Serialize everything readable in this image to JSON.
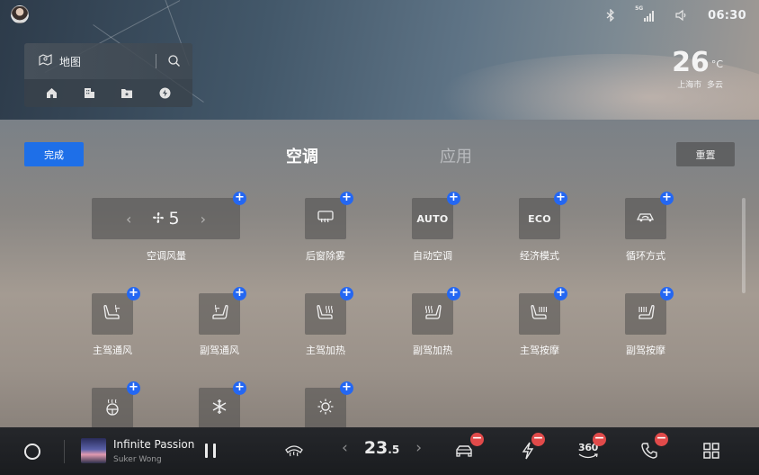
{
  "status_bar": {
    "network": "5G",
    "time": "06:30",
    "icons": [
      "bluetooth-icon",
      "signal-5g-icon",
      "volume-icon"
    ]
  },
  "map_widget": {
    "search_label": "地图",
    "icons": [
      "map-pin-icon",
      "search-icon"
    ],
    "shortcuts": [
      "home-icon",
      "office-icon",
      "favorite-folder-icon",
      "charging-icon"
    ]
  },
  "weather": {
    "temperature": "26",
    "unit": "°C",
    "location": "上海市",
    "condition": "多云"
  },
  "panel": {
    "done_label": "完成",
    "reset_label": "重置",
    "tabs": [
      {
        "label": "空调",
        "active": true
      },
      {
        "label": "应用",
        "active": false
      }
    ]
  },
  "tiles": [
    {
      "label": "空调风量",
      "icon": "fan-icon",
      "value": "5",
      "type": "fan-speed"
    },
    {
      "label": "后窗除雾",
      "icon": "rear-defrost-icon"
    },
    {
      "label": "自动空调",
      "icon_text": "AUTO"
    },
    {
      "label": "经济模式",
      "icon_text": "ECO"
    },
    {
      "label": "循环方式",
      "icon": "air-recirculation-icon"
    },
    {
      "label": "主驾通风",
      "icon": "seat-ventilation-icon"
    },
    {
      "label": "副驾通风",
      "icon": "seat-ventilation-icon"
    },
    {
      "label": "主驾加热",
      "icon": "seat-heating-icon"
    },
    {
      "label": "副驾加热",
      "icon": "seat-heating-icon"
    },
    {
      "label": "主驾按摩",
      "icon": "seat-massage-icon"
    },
    {
      "label": "副驾按摩",
      "icon": "seat-massage-icon"
    },
    {
      "label": "",
      "icon": "steering-heat-icon"
    },
    {
      "label": "",
      "icon": "snowflake-icon"
    },
    {
      "label": "",
      "icon": "brightness-icon"
    }
  ],
  "dock": {
    "song_title": "Infinite Passion",
    "artist": "Suker Wong",
    "temperature_whole": "23",
    "temperature_decimal": ".5",
    "text_360": "360",
    "icons": [
      "home-circle-icon",
      "pause-icon",
      "defrost-icon",
      "chevron-left-icon",
      "chevron-right-icon",
      "car-icon",
      "energy-icon",
      "camera-360-icon",
      "phone-icon",
      "apps-grid-icon"
    ]
  }
}
